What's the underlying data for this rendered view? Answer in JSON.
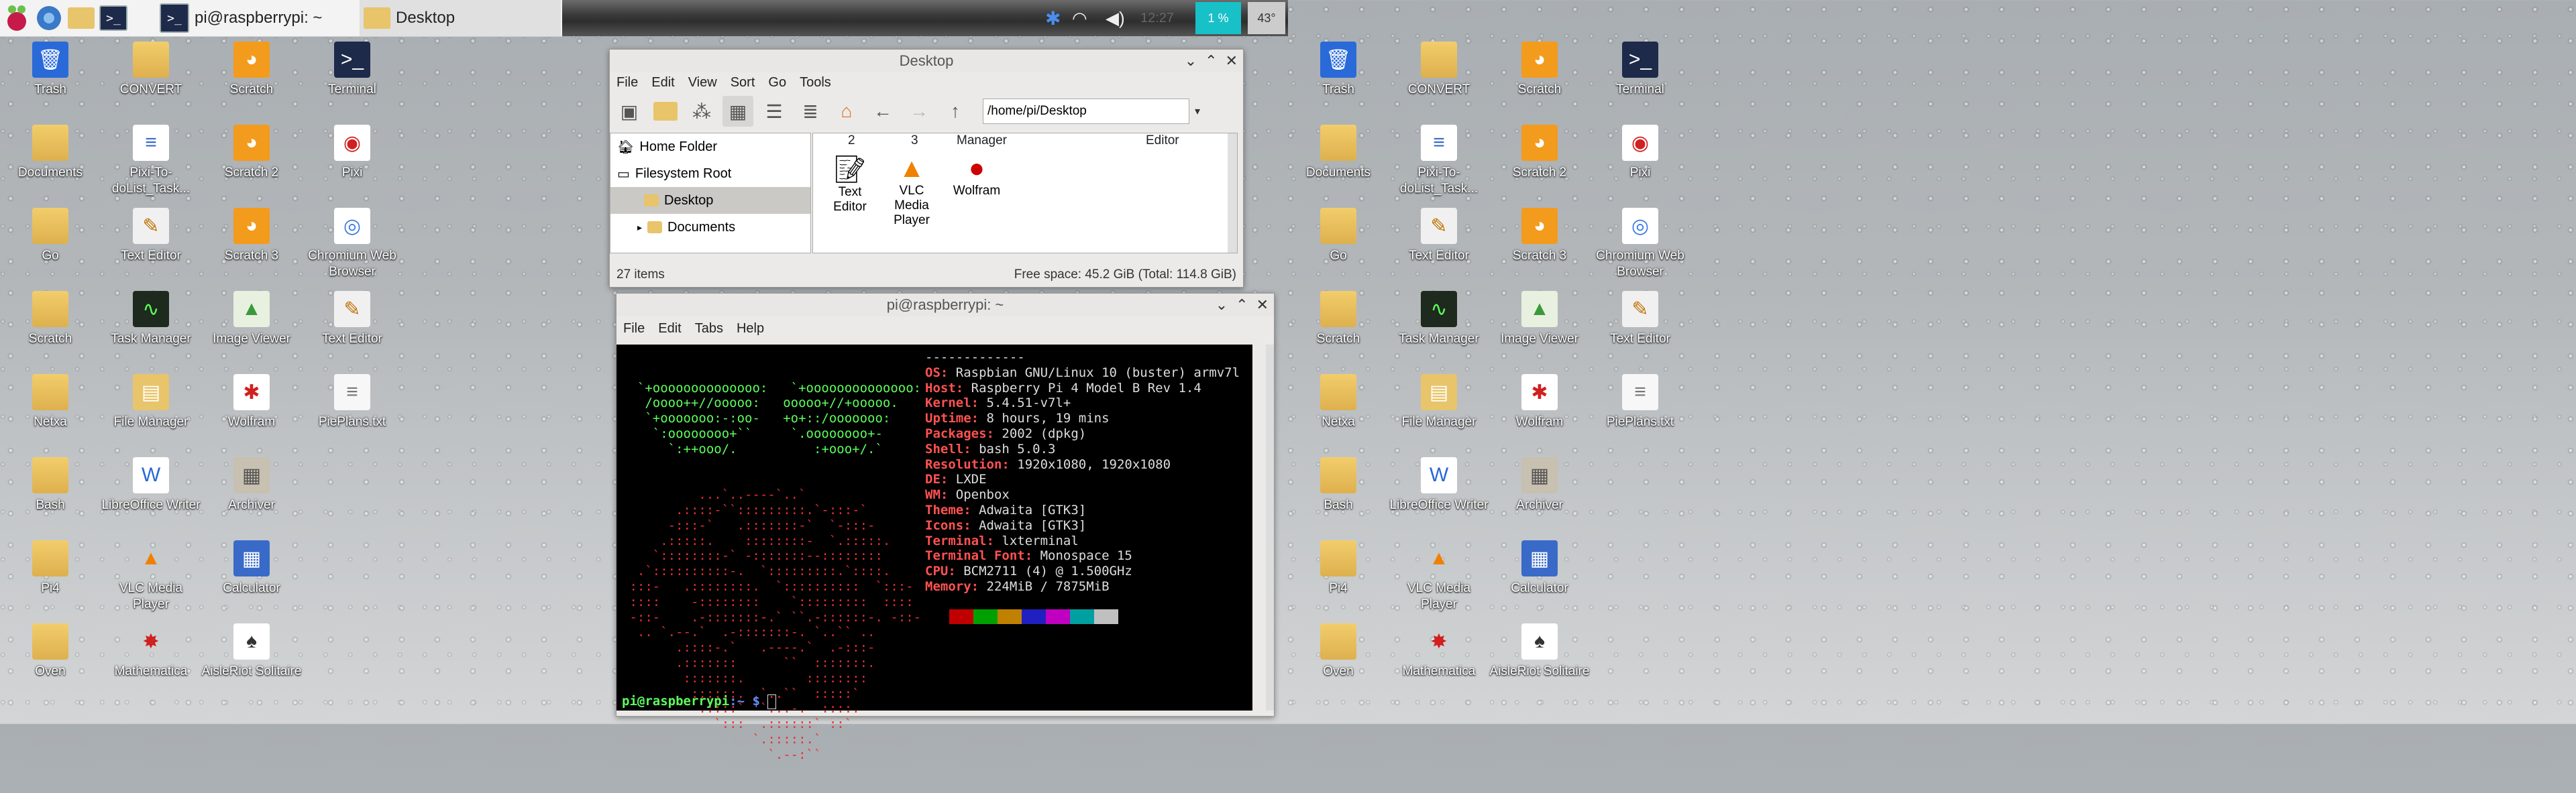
{
  "taskbar": {
    "tasks": [
      {
        "label": "pi@raspberrypi: ~",
        "icon": "terminal-icon"
      },
      {
        "label": "Desktop",
        "icon": "folder-icon"
      }
    ],
    "cpu": "1 %",
    "temp": "43°"
  },
  "desktop_icons_left": [
    {
      "label": "Trash",
      "icon": "trash-icon"
    },
    {
      "label": "CONVERT",
      "icon": "folder-icon"
    },
    {
      "label": "Scratch",
      "icon": "scratch-icon"
    },
    {
      "label": "Terminal",
      "icon": "terminal-icon"
    },
    {
      "label": "Documents",
      "icon": "folder-icon"
    },
    {
      "label": "Pixi-To-doList_Task...",
      "icon": "document-icon"
    },
    {
      "label": "Scratch 2",
      "icon": "scratch-icon"
    },
    {
      "label": "Pixi",
      "icon": "pixi-icon"
    },
    {
      "label": "Go",
      "icon": "folder-icon"
    },
    {
      "label": "Text Editor",
      "icon": "editor-icon"
    },
    {
      "label": "Scratch 3",
      "icon": "scratch-icon"
    },
    {
      "label": "Chromium Web Browser",
      "icon": "chromium-icon"
    },
    {
      "label": "Scratch",
      "icon": "folder-icon"
    },
    {
      "label": "Task Manager",
      "icon": "task-manager-icon"
    },
    {
      "label": "Image Viewer",
      "icon": "image-icon"
    },
    {
      "label": "Text Editor",
      "icon": "editor-icon"
    },
    {
      "label": "Netxa",
      "icon": "folder-icon"
    },
    {
      "label": "File Manager",
      "icon": "file-manager-icon"
    },
    {
      "label": "Wolfram",
      "icon": "wolfram-icon"
    },
    {
      "label": "PiePlans.txt",
      "icon": "text-file-icon"
    },
    {
      "label": "Bash",
      "icon": "folder-icon"
    },
    {
      "label": "LibreOffice Writer",
      "icon": "writer-icon"
    },
    {
      "label": "Archiver",
      "icon": "archive-icon"
    },
    {
      "label": "",
      "icon": ""
    },
    {
      "label": "Pi4",
      "icon": "folder-icon"
    },
    {
      "label": "VLC Media Player",
      "icon": "vlc-icon"
    },
    {
      "label": "Calculator",
      "icon": "calculator-icon"
    },
    {
      "label": "",
      "icon": ""
    },
    {
      "label": "Oven",
      "icon": "folder-icon"
    },
    {
      "label": "Mathematica",
      "icon": "mathematica-icon"
    },
    {
      "label": "AisleRiot Solitaire",
      "icon": "cards-icon"
    }
  ],
  "desktop_icons_right": [
    {
      "label": "Trash",
      "icon": "trash-icon"
    },
    {
      "label": "CONVERT",
      "icon": "folder-icon"
    },
    {
      "label": "Scratch",
      "icon": "scratch-icon"
    },
    {
      "label": "Terminal",
      "icon": "terminal-icon"
    },
    {
      "label": "Documents",
      "icon": "folder-icon"
    },
    {
      "label": "Pixi-To-doList_Task...",
      "icon": "document-icon"
    },
    {
      "label": "Scratch 2",
      "icon": "scratch-icon"
    },
    {
      "label": "Pixi",
      "icon": "pixi-icon"
    },
    {
      "label": "Go",
      "icon": "folder-icon"
    },
    {
      "label": "Text Editor",
      "icon": "editor-icon"
    },
    {
      "label": "Scratch 3",
      "icon": "scratch-icon"
    },
    {
      "label": "Chromium Web Browser",
      "icon": "chromium-icon"
    },
    {
      "label": "Scratch",
      "icon": "folder-icon"
    },
    {
      "label": "Task Manager",
      "icon": "task-manager-icon"
    },
    {
      "label": "Image Viewer",
      "icon": "image-icon"
    },
    {
      "label": "Text Editor",
      "icon": "editor-icon"
    },
    {
      "label": "Netxa",
      "icon": "folder-icon"
    },
    {
      "label": "File Manager",
      "icon": "file-manager-icon"
    },
    {
      "label": "Wolfram",
      "icon": "wolfram-icon"
    },
    {
      "label": "PiePlans.txt",
      "icon": "text-file-icon"
    },
    {
      "label": "Bash",
      "icon": "folder-icon"
    },
    {
      "label": "LibreOffice Writer",
      "icon": "writer-icon"
    },
    {
      "label": "Archiver",
      "icon": "archive-icon"
    },
    {
      "label": "",
      "icon": ""
    },
    {
      "label": "Pi4",
      "icon": "folder-icon"
    },
    {
      "label": "VLC Media Player",
      "icon": "vlc-icon"
    },
    {
      "label": "Calculator",
      "icon": "calculator-icon"
    },
    {
      "label": "",
      "icon": ""
    },
    {
      "label": "Oven",
      "icon": "folder-icon"
    },
    {
      "label": "Mathematica",
      "icon": "mathematica-icon"
    },
    {
      "label": "AisleRiot Solitaire",
      "icon": "cards-icon"
    }
  ],
  "file_manager": {
    "title": "Desktop",
    "menu": [
      "File",
      "Edit",
      "View",
      "Sort",
      "Go",
      "Tools"
    ],
    "path": "/home/pi/Desktop",
    "places": [
      "Home Folder",
      "Filesystem Root"
    ],
    "tree": [
      "Desktop",
      "Documents"
    ],
    "header_fragments": [
      "2",
      "3",
      "Manager",
      "Editor"
    ],
    "items": [
      "Text Editor",
      "VLC Media Player",
      "Wolfram"
    ],
    "item_count": "27 items",
    "free_space": "Free space: 45.2 GiB (Total: 114.8 GiB)"
  },
  "terminal": {
    "title": "pi@raspberrypi: ~",
    "menu": [
      "File",
      "Edit",
      "Tabs",
      "Help"
    ],
    "ascii_green": "  `+oooooooooooooo:   `+oooooooooooooo:\n   /oooo++//ooooo:   ooooo+//+ooooo.\n   `+ooooooo:-:oo-   +o+::/ooooooo:\n    `:oooooooo+``     `.oooooooo+-\n      `:++ooo/.          :+ooo+/.`",
    "ascii_red": "          ...`..----`..`\n       .::::-``:::::::::.`-:::-`\n      -:::-`   .:::::::-`  `-:::-\n     .:::::.    ::::::::-  `.:::::.\n    `::::::::-` -:::::::--::::::::\n  .`::::::::::-.  `:::::::::.`::::.\n :::-   .::::::::.  `::::::::::  `:::-\n ::::    -::::::::    `:::::::::  ::::\n -::-    .-:::::::-.` ``.-::::::-. -::-\n  .. `.--.`  .-:::::::-. `..`` ..\n       .::::-.`   .----.`  .-:::-\n       .:::::::      ``  :::::::.\n        :::::::.        ::::::::\n         ::::::.  `..``  :::::`\n          .::::`  `...-.  ::::.\n            `:::  .::::::` ::`\n                 `.:::::.`\n                   `.--:``",
    "info_lines": [
      {
        "key": "",
        "value": "-------------"
      },
      {
        "key": "OS",
        "value": "Raspbian GNU/Linux 10 (buster) armv7l"
      },
      {
        "key": "Host",
        "value": "Raspberry Pi 4 Model B Rev 1.4"
      },
      {
        "key": "Kernel",
        "value": "5.4.51-v7l+"
      },
      {
        "key": "Uptime",
        "value": "8 hours, 19 mins"
      },
      {
        "key": "Packages",
        "value": "2002 (dpkg)"
      },
      {
        "key": "Shell",
        "value": "bash 5.0.3"
      },
      {
        "key": "Resolution",
        "value": "1920x1080, 1920x1080"
      },
      {
        "key": "DE",
        "value": "LXDE"
      },
      {
        "key": "WM",
        "value": "Openbox"
      },
      {
        "key": "Theme",
        "value": "Adwaita [GTK3]"
      },
      {
        "key": "Icons",
        "value": "Adwaita [GTK3]"
      },
      {
        "key": "Terminal",
        "value": "lxterminal"
      },
      {
        "key": "Terminal Font",
        "value": "Monospace 15"
      },
      {
        "key": "CPU",
        "value": "BCM2711 (4) @ 1.500GHz"
      },
      {
        "key": "Memory",
        "value": "224MiB / 7875MiB"
      }
    ],
    "swatches": [
      "#000000",
      "#c00000",
      "#00a000",
      "#c08000",
      "#2020c0",
      "#c000c0",
      "#00a0a0",
      "#c0c0c0"
    ],
    "prompt_user": "pi@raspberrypi",
    "prompt_path": ":~ $ "
  }
}
